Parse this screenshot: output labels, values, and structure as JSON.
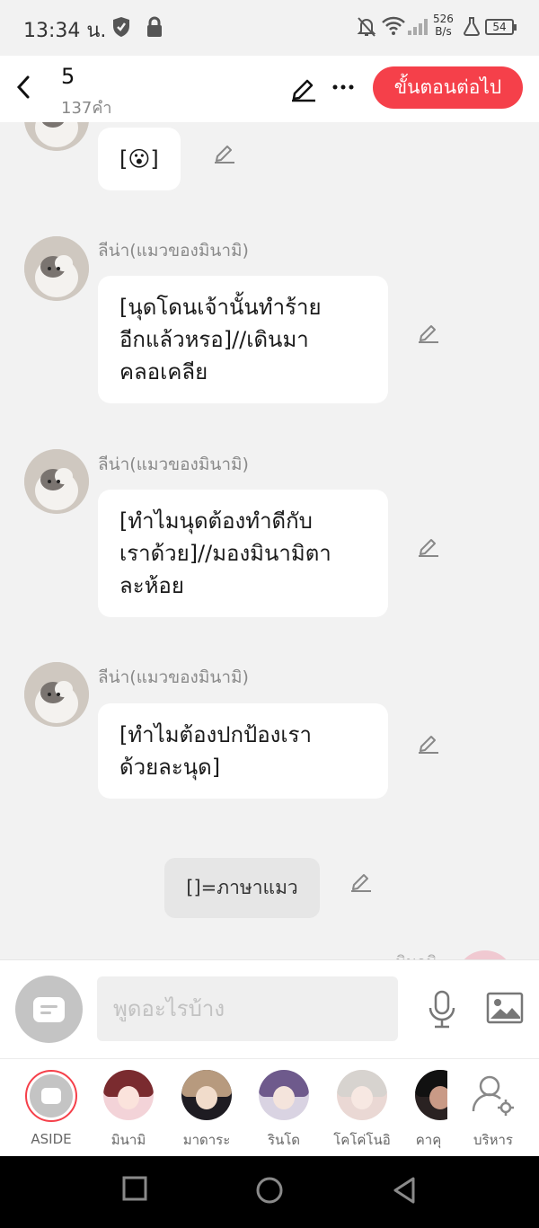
{
  "status_bar": {
    "time": "13:34 น.",
    "net_speed_value": "526",
    "net_speed_unit": "B/s",
    "battery": "54"
  },
  "header": {
    "title": "5",
    "word_count": "137คำ",
    "next_button": "ขั้นตอนต่อไป"
  },
  "messages": [
    {
      "sender": "",
      "text": "[😮]"
    },
    {
      "sender": "ลีน่า(แมวของมินามิ)",
      "lines": [
        "[นุดโดนเจ้านั้นทำร้าย",
        "อีกแล้วหรอ]//เดินมา",
        "คลอเคลีย"
      ]
    },
    {
      "sender": "ลีน่า(แมวของมินามิ)",
      "lines": [
        "[ทำไมนุดต้องทำดีกับ",
        "เราด้วย]//มองมินามิตา",
        "ละห้อย"
      ]
    },
    {
      "sender": "ลีน่า(แมวของมินามิ)",
      "lines": [
        "[ทำไมต้องปกป้องเรา",
        "ด้วยละนุด]"
      ]
    }
  ],
  "narration": {
    "text": "[]=ภาษาแมว"
  },
  "next_sender_peek": "มินามิ",
  "input": {
    "placeholder": "พูดอะไรบ้าง"
  },
  "characters": [
    {
      "name": "ASIDE"
    },
    {
      "name": "มินามิ"
    },
    {
      "name": "มาดาระ"
    },
    {
      "name": "รินโด"
    },
    {
      "name": "โคโค่โนอิ"
    },
    {
      "name": "คาคุ"
    },
    {
      "name": "บริหาร"
    }
  ],
  "colors": {
    "accent": "#f5404a",
    "background": "#f2f2f2",
    "bubble": "#ffffff",
    "narration_bubble": "#e6e6e6"
  }
}
